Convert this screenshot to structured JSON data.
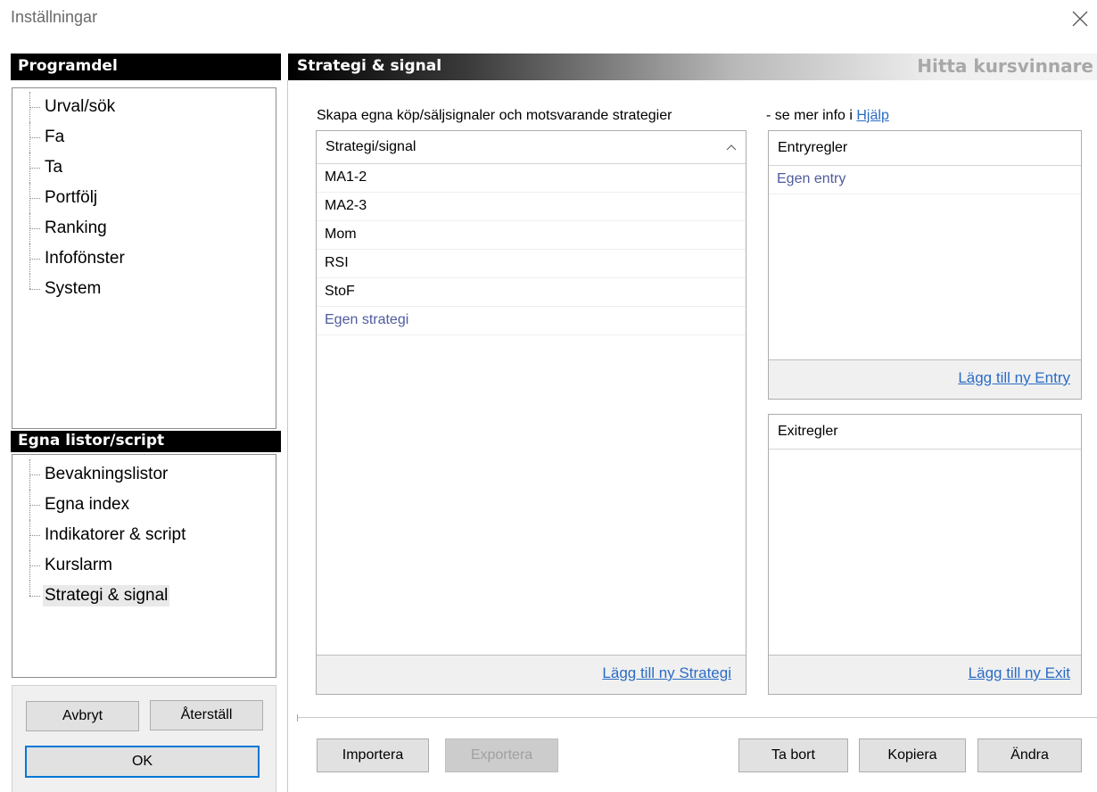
{
  "window": {
    "title": "Inställningar"
  },
  "sidebar": {
    "section1_title": "Programdel",
    "section1_items": [
      {
        "label": "Urval/sök"
      },
      {
        "label": "Fa"
      },
      {
        "label": "Ta"
      },
      {
        "label": "Portfölj"
      },
      {
        "label": "Ranking"
      },
      {
        "label": "Infofönster"
      },
      {
        "label": "System"
      }
    ],
    "section2_title": "Egna listor/script",
    "section2_items": [
      {
        "label": "Bevakningslistor"
      },
      {
        "label": "Egna index"
      },
      {
        "label": "Indikatorer & script"
      },
      {
        "label": "Kurslarm"
      },
      {
        "label": "Strategi & signal",
        "selected": true
      }
    ],
    "buttons": {
      "cancel": "Avbryt",
      "reset": "Återställ",
      "ok": "OK"
    }
  },
  "main": {
    "header_title": "Strategi & signal",
    "header_brand": "Hitta kursvinnare",
    "intro": "Skapa egna köp/säljsignaler och motsvarande strategier",
    "info_prefix": "- se mer info i",
    "help_link": "Hjälp",
    "strategy_list": {
      "column_header": "Strategi/signal",
      "rows": [
        {
          "label": "MA1-2"
        },
        {
          "label": "MA2-3"
        },
        {
          "label": "Mom"
        },
        {
          "label": "RSI"
        },
        {
          "label": "StoF"
        },
        {
          "label": "Egen strategi"
        }
      ],
      "add_link": "Lägg till ny Strategi"
    },
    "entry_rules": {
      "column_header": "Entryregler",
      "rows": [
        {
          "label": "Egen entry"
        }
      ],
      "add_link": "Lägg till ny Entry"
    },
    "exit_rules": {
      "column_header": "Exitregler",
      "rows": [],
      "add_link": "Lägg till ny Exit"
    },
    "buttons": {
      "import": "Importera",
      "export": "Exportera",
      "delete": "Ta bort",
      "copy": "Kopiera",
      "edit": "Ändra"
    }
  },
  "colors": {
    "accent": "#0078d7",
    "link": "#2b6cc4",
    "custom_item": "#4e5b9e"
  }
}
